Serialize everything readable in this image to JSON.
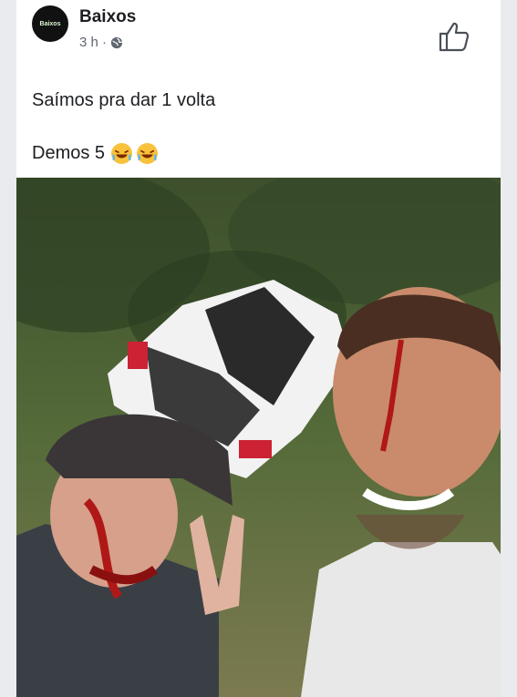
{
  "post": {
    "author": "Baixos",
    "avatar_text": "Baixos",
    "time": "3 h ·",
    "line1": "Saímos pra dar 1 volta",
    "line2": "Demos 5",
    "emojis": [
      "rolling-on-floor-laughing",
      "rolling-on-floor-laughing"
    ]
  },
  "icons": {
    "like": "thumbs-up-icon",
    "privacy": "globe-icon"
  },
  "colors": {
    "text": "#1c1e21",
    "meta": "#606770",
    "background": "#ffffff"
  }
}
